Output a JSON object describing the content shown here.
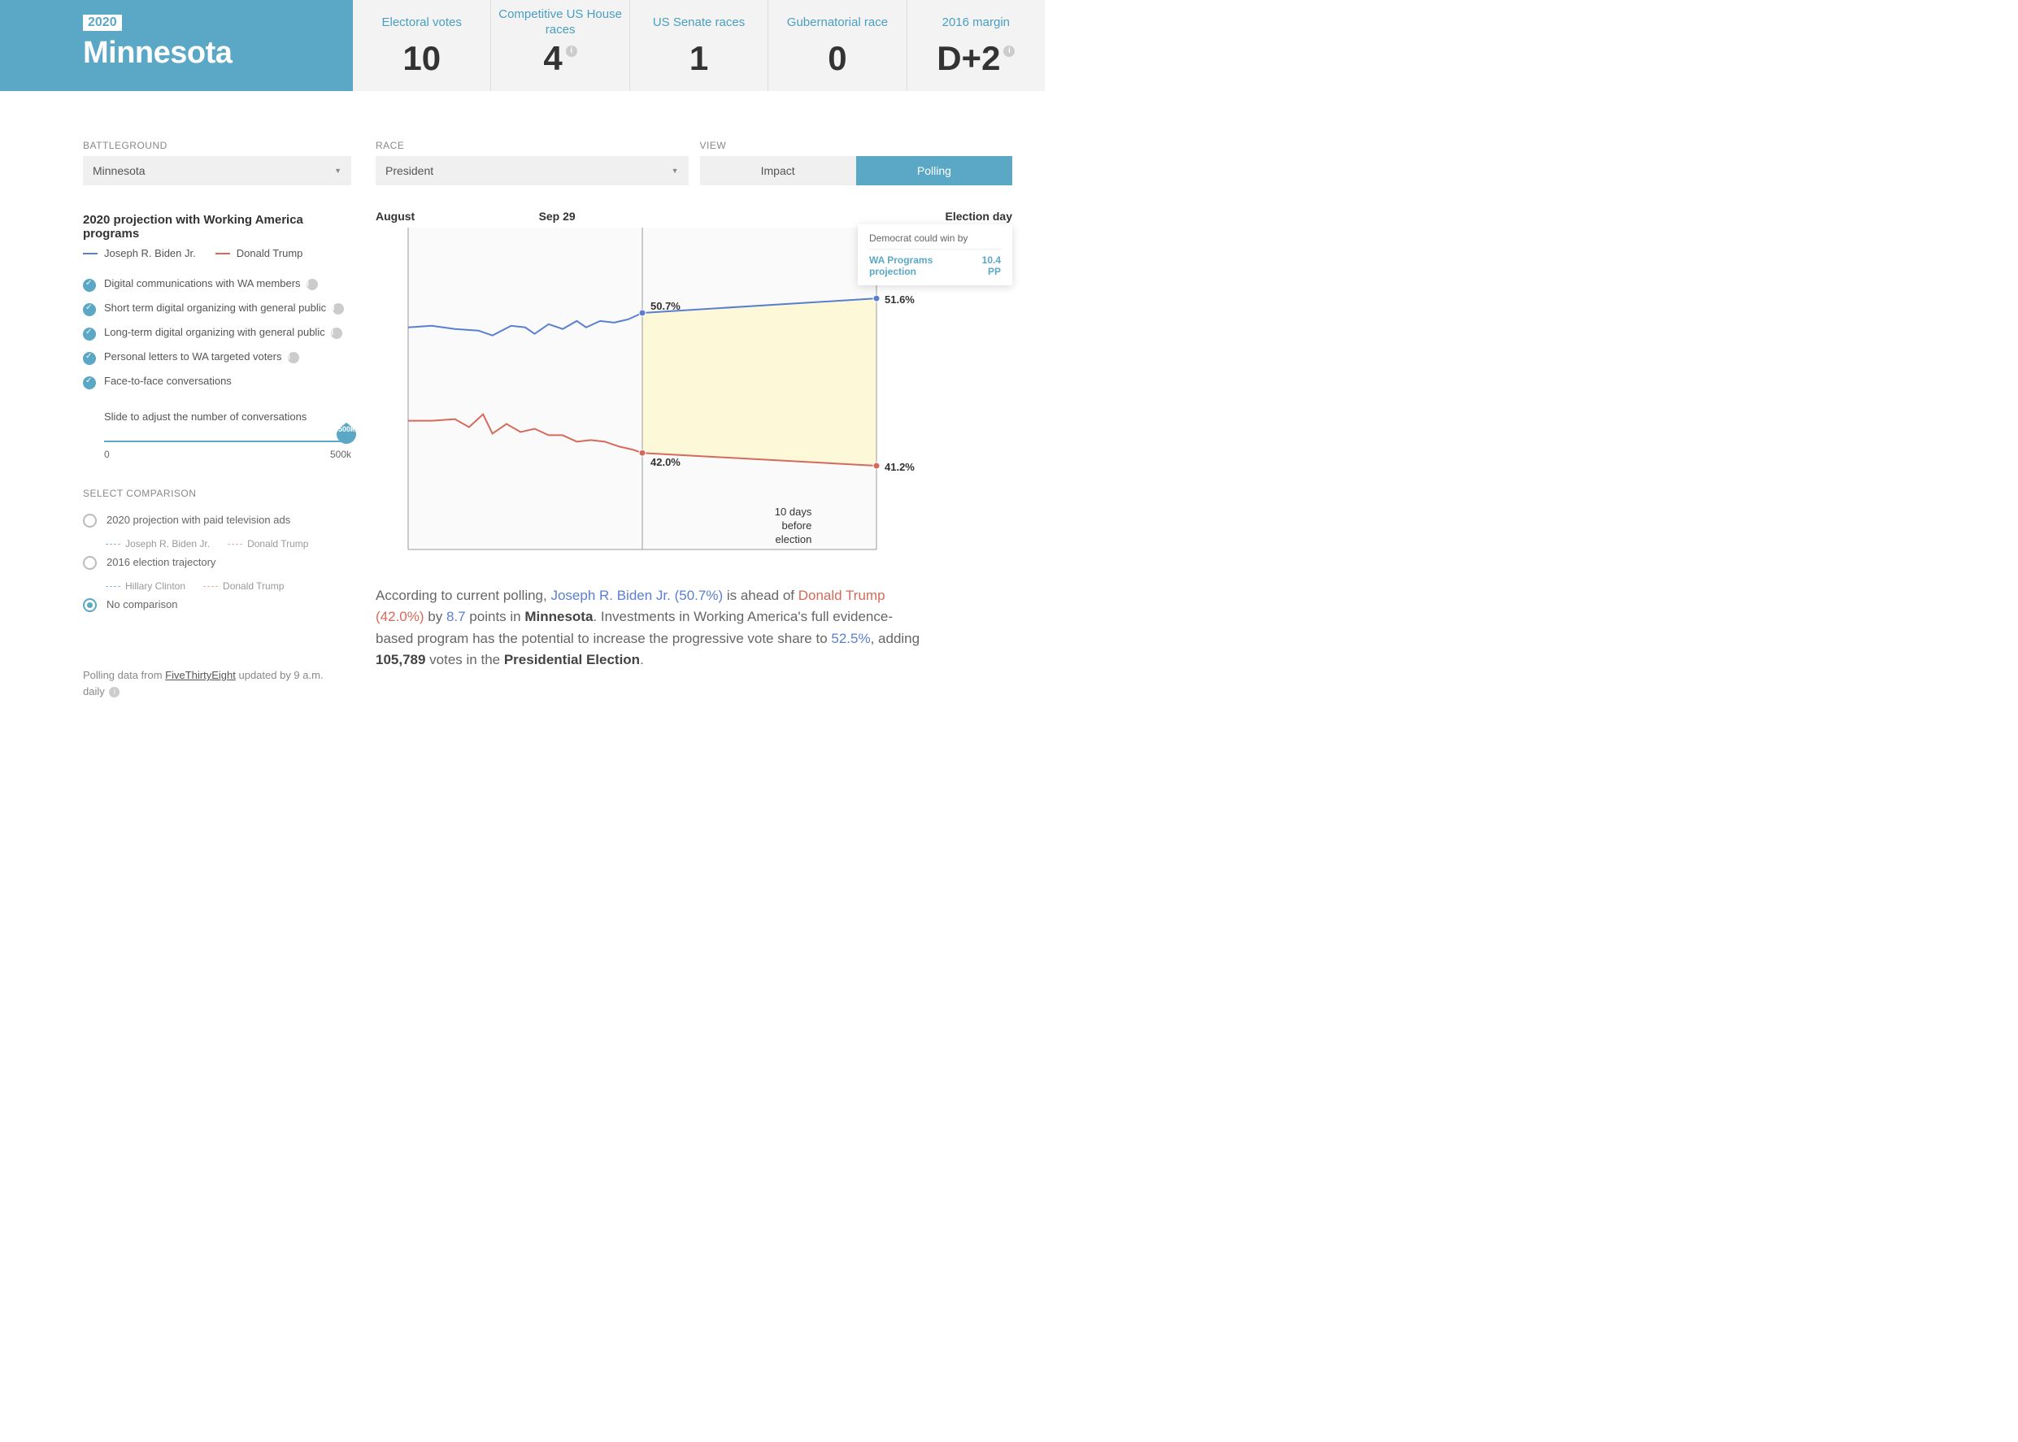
{
  "header": {
    "year": "2020",
    "state": "Minnesota",
    "stats": [
      {
        "label": "Electoral votes",
        "value": "10",
        "info": false
      },
      {
        "label": "Competitive US House races",
        "value": "4",
        "info": true
      },
      {
        "label": "US Senate races",
        "value": "1",
        "info": false
      },
      {
        "label": "Gubernatorial race",
        "value": "0",
        "info": false
      },
      {
        "label": "2016 margin",
        "value": "D+2",
        "info": true
      }
    ]
  },
  "controls": {
    "battleground_label": "BATTLEGROUND",
    "battleground_value": "Minnesota",
    "race_label": "RACE",
    "race_value": "President",
    "view_label": "VIEW",
    "view_options": [
      "Impact",
      "Polling"
    ],
    "view_selected": 1
  },
  "projection": {
    "title": "2020 projection with Working America programs",
    "legend": [
      {
        "name": "Joseph R. Biden Jr.",
        "color": "#5a7fd1"
      },
      {
        "name": "Donald Trump",
        "color": "#d56a5a"
      }
    ],
    "programs": [
      "Digital communications with WA members",
      "Short term digital organizing with general public",
      "Long-term digital organizing with general public",
      "Personal letters to WA targeted voters",
      "Face-to-face conversations"
    ],
    "slider_caption": "Slide to adjust the number of conversations",
    "slider_value_label": "500k",
    "slider_min": "0",
    "slider_max": "500k"
  },
  "comparison": {
    "label": "SELECT COMPARISON",
    "options": [
      {
        "label": "2020 projection with paid television ads",
        "sub": [
          {
            "name": "Joseph R. Biden Jr.",
            "color": "#9ab0e0"
          },
          {
            "name": "Donald Trump",
            "color": "#e6b0a5"
          }
        ]
      },
      {
        "label": "2016 election trajectory",
        "sub": [
          {
            "name": "Hillary Clinton",
            "color": "#9ab0e0"
          },
          {
            "name": "Donald Trump",
            "color": "#e6b0a5"
          }
        ]
      },
      {
        "label": "No comparison"
      }
    ],
    "selected": 2
  },
  "chart_data": {
    "type": "line",
    "xlabels": [
      "August",
      "Sep 29",
      "Election day"
    ],
    "ylim_approx": [
      36,
      56
    ],
    "series": [
      {
        "name": "Joseph R. Biden Jr.",
        "color": "#5a7fd1",
        "points": [
          [
            0,
            49.8
          ],
          [
            5,
            49.9
          ],
          [
            10,
            49.7
          ],
          [
            15,
            49.6
          ],
          [
            18,
            49.3
          ],
          [
            22,
            49.9
          ],
          [
            25,
            49.8
          ],
          [
            27,
            49.4
          ],
          [
            30,
            50.0
          ],
          [
            33,
            49.7
          ],
          [
            36,
            50.2
          ],
          [
            38,
            49.8
          ],
          [
            41,
            50.2
          ],
          [
            44,
            50.1
          ],
          [
            47,
            50.3
          ],
          [
            50,
            50.7
          ],
          [
            100,
            51.6
          ]
        ],
        "marker_at_x": 50,
        "label_mid": "50.7%",
        "label_end": "51.6%"
      },
      {
        "name": "Donald Trump",
        "color": "#d56a5a",
        "points": [
          [
            0,
            44.0
          ],
          [
            5,
            44.0
          ],
          [
            10,
            44.1
          ],
          [
            13,
            43.6
          ],
          [
            16,
            44.4
          ],
          [
            18,
            43.2
          ],
          [
            21,
            43.8
          ],
          [
            24,
            43.3
          ],
          [
            27,
            43.5
          ],
          [
            30,
            43.1
          ],
          [
            33,
            43.1
          ],
          [
            36,
            42.7
          ],
          [
            39,
            42.8
          ],
          [
            42,
            42.7
          ],
          [
            45,
            42.4
          ],
          [
            48,
            42.2
          ],
          [
            50,
            42.0
          ],
          [
            100,
            41.2
          ]
        ],
        "marker_at_x": 50,
        "label_mid": "42.0%",
        "label_end": "41.2%"
      }
    ],
    "projection_fill": "#fdf8d8",
    "vline_x": 50,
    "bottom_note": "10 days\nbefore\nelection"
  },
  "tooltip": {
    "title": "Democrat could win by",
    "row_label": "WA Programs projection",
    "row_value": "10.4 PP"
  },
  "summary": {
    "lead_in": "According to current polling, ",
    "candidate_a": "Joseph R. Biden Jr. (50.7%)",
    "mid1": " is ahead of ",
    "candidate_b": "Donald Trump (42.0%)",
    "mid2": " by ",
    "margin": "8.7",
    "mid3": " points in ",
    "state_strong": "Minnesota",
    "tail1": ". Investments in Working America's full evidence-based program has the potential to increase the progressive vote share to ",
    "target_pct": "52.5%",
    "tail2": ", adding ",
    "votes_strong": "105,789",
    "tail3": " votes in the ",
    "race_strong": "Presidential Election",
    "tail4": "."
  },
  "footnote": {
    "pre": "Polling data from ",
    "source": "FiveThirtyEight",
    "post": " updated by 9 a.m. daily"
  }
}
